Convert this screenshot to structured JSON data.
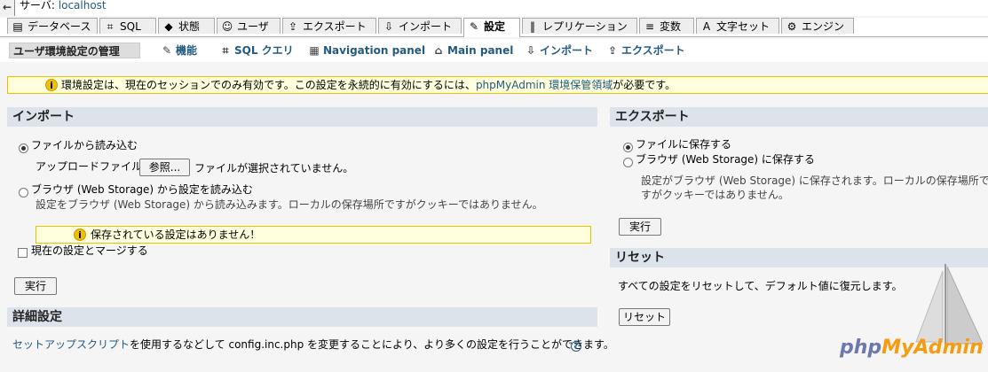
{
  "server_bar": {
    "back_glyph": "←",
    "label": "サーバ:",
    "name": "localhost"
  },
  "tabs": [
    {
      "label": "データベース",
      "icon": "database-icon",
      "glyph": "▤"
    },
    {
      "label": "SQL",
      "icon": "sql-icon",
      "glyph": "⌗"
    },
    {
      "label": "状態",
      "icon": "status-icon",
      "glyph": "◆"
    },
    {
      "label": "ユーザ",
      "icon": "users-icon",
      "glyph": "☺"
    },
    {
      "label": "エクスポート",
      "icon": "export-icon",
      "glyph": "⇪"
    },
    {
      "label": "インポート",
      "icon": "import-icon",
      "glyph": "⇩"
    },
    {
      "label": "設定",
      "icon": "settings-icon",
      "glyph": "✎"
    },
    {
      "label": "レプリケーション",
      "icon": "replication-icon",
      "glyph": "‖"
    },
    {
      "label": "変数",
      "icon": "variables-icon",
      "glyph": "≡"
    },
    {
      "label": "文字セット",
      "icon": "charset-icon",
      "glyph": "A"
    },
    {
      "label": "エンジン",
      "icon": "engines-icon",
      "glyph": "⚙"
    }
  ],
  "subnav": [
    {
      "label": "ユーザ環境設定の管理",
      "icon": "",
      "glyph": ""
    },
    {
      "label": "機能",
      "icon": "features-icon",
      "glyph": "✎"
    },
    {
      "label": "SQL クエリ",
      "icon": "sql-query-icon",
      "glyph": "⌗"
    },
    {
      "label": "Navigation panel",
      "icon": "navigation-panel-icon",
      "glyph": "▦"
    },
    {
      "label": "Main panel",
      "icon": "main-panel-icon",
      "glyph": "⌂"
    },
    {
      "label": "インポート",
      "icon": "import-icon",
      "glyph": "⇩"
    },
    {
      "label": "エクスポート",
      "icon": "export-icon",
      "glyph": "⇪"
    }
  ],
  "notice": {
    "before": "環境設定は、現在のセッションでのみ有効です。この設定を永続的に有効にするには、",
    "link": "phpMyAdmin 環境保管領域",
    "after": "が必要です。"
  },
  "import": {
    "title": "インポート",
    "from_file_label": "ファイルから読み込む",
    "upload_label": "アップロードファイル:",
    "browse_button": "参照...",
    "no_file_text": "ファイルが選択されていません。",
    "from_browser_label": "ブラウザ (Web Storage) から設定を読み込む",
    "from_browser_desc": "設定をブラウザ (Web Storage) から読み込みます。ローカルの保存場所ですがクッキーではありません。",
    "no_saved_warning": "保存されている設定はありません！",
    "merge_label": "現在の設定とマージする",
    "go_button": "実行"
  },
  "advanced": {
    "title": "詳細設定",
    "link": "セットアップスクリプト",
    "text": "を使用するなどして config.inc.php を変更することにより、より多くの設定を行うことができます。"
  },
  "export": {
    "title": "エクスポート",
    "to_file_label": "ファイルに保存する",
    "to_browser_label": "ブラウザ (Web Storage) に保存する",
    "desc_line1": "設定がブラウザ (Web Storage) に保存されます。ローカルの保存場所で",
    "desc_line2": "すがクッキーではありません。",
    "go_button": "実行"
  },
  "reset": {
    "title": "リセット",
    "desc": "すべての設定をリセットして、デフォルト値に復元します。",
    "button": "リセット"
  },
  "logo": {
    "php": "php",
    "my": "My",
    "admin": "Admin"
  },
  "colors": {
    "accent": "#235a81",
    "notice_bg": "#ffffdd",
    "notice_border": "#e5c500",
    "panel_head": "#dde3ea"
  }
}
